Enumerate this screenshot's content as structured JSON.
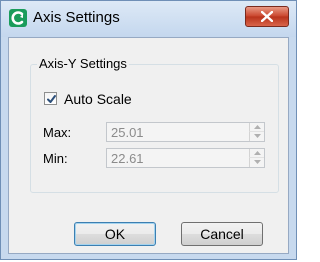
{
  "window": {
    "title": "Axis Settings"
  },
  "group": {
    "label": "Axis-Y Settings"
  },
  "auto_scale": {
    "label": "Auto Scale",
    "checked": true
  },
  "fields": {
    "max": {
      "label": "Max:",
      "value": "25.01",
      "disabled": true
    },
    "min": {
      "label": "Min:",
      "value": "22.61",
      "disabled": true
    }
  },
  "buttons": {
    "ok": "OK",
    "cancel": "Cancel"
  },
  "colors": {
    "titlebar": "#c4d7ee",
    "close": "#c9432a",
    "dialog": "#f0f0f0"
  },
  "icons": {
    "app": "app-logo-icon",
    "close": "close-icon"
  }
}
